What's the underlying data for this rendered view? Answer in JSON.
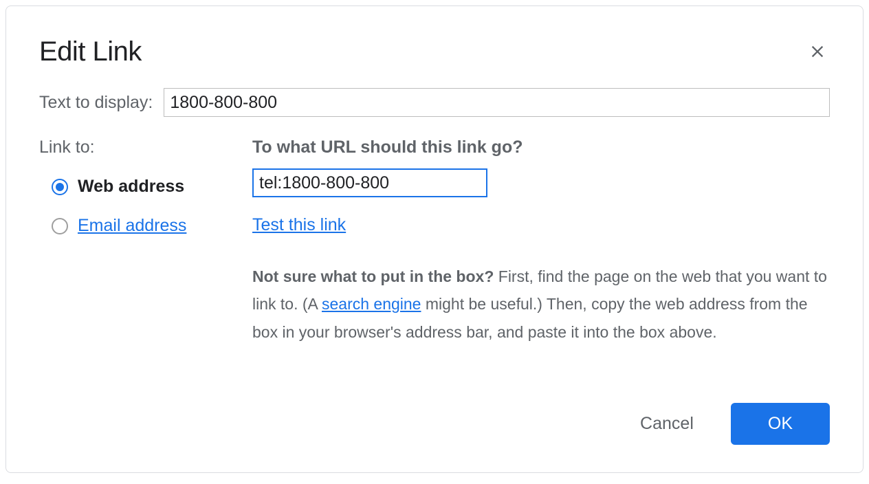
{
  "dialog": {
    "title": "Edit Link",
    "text_to_display_label": "Text to display:",
    "text_to_display_value": "1800-800-800",
    "link_to_label": "Link to:",
    "radio_web_label": "Web address",
    "radio_email_label": "Email address",
    "url_question": "To what URL should this link go?",
    "url_value": "tel:1800-800-800",
    "test_link_label": "Test this link",
    "help_bold": "Not sure what to put in the box?",
    "help_part1": " First, find the page on the web that you want to link to. (A ",
    "help_search_engine": "search engine",
    "help_part2": " might be useful.) Then, copy the web address from the box in your browser's address bar, and paste it into the box above.",
    "cancel_label": "Cancel",
    "ok_label": "OK"
  }
}
